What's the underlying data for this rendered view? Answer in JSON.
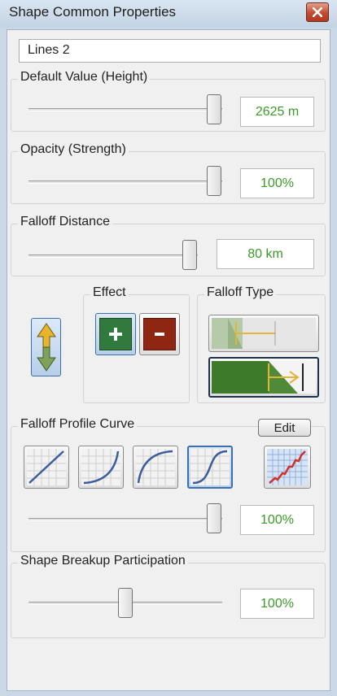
{
  "window": {
    "title": "Shape Common Properties"
  },
  "shape_name": "Lines 2",
  "default_value": {
    "label": "Default Value (Height)",
    "value": "2625 m",
    "slider_level": 0.98
  },
  "opacity": {
    "label": "Opacity (Strength)",
    "value": "100%",
    "slider_level": 1.0
  },
  "falloff_distance": {
    "label": "Falloff Distance",
    "value": "80 km",
    "slider_level": 1.0
  },
  "direction_toggle": {
    "icon": "up-down-arrows-icon"
  },
  "effect": {
    "label": "Effect",
    "buttons": [
      {
        "icon": "plus-icon",
        "selected": true
      },
      {
        "icon": "minus-icon",
        "selected": false
      }
    ]
  },
  "falloff_type": {
    "label": "Falloff Type",
    "options": [
      {
        "icon": "falloff-inside-icon",
        "selected": false
      },
      {
        "icon": "falloff-outside-icon",
        "selected": true
      }
    ]
  },
  "falloff_profile": {
    "label": "Falloff Profile Curve",
    "edit_label": "Edit",
    "curves": [
      {
        "icon": "linear-curve-icon",
        "selected": false
      },
      {
        "icon": "ease-in-curve-icon",
        "selected": false
      },
      {
        "icon": "ease-out-curve-icon",
        "selected": false
      },
      {
        "icon": "s-curve-icon",
        "selected": true
      }
    ],
    "custom_curve_icon": "custom-curve-icon",
    "value": "100%",
    "slider_level": 1.0
  },
  "shape_breakup": {
    "label": "Shape Breakup Participation",
    "value": "100%",
    "slider_level": 0.5
  },
  "colors": {
    "value_text": "#3a9a28",
    "effect_add": "#2f7a3c",
    "effect_subtract": "#8e2612",
    "falloff_green": "#3d7a2a",
    "curve_stroke": "#3c5d9a",
    "custom_curve_stroke": "#d2302a"
  }
}
